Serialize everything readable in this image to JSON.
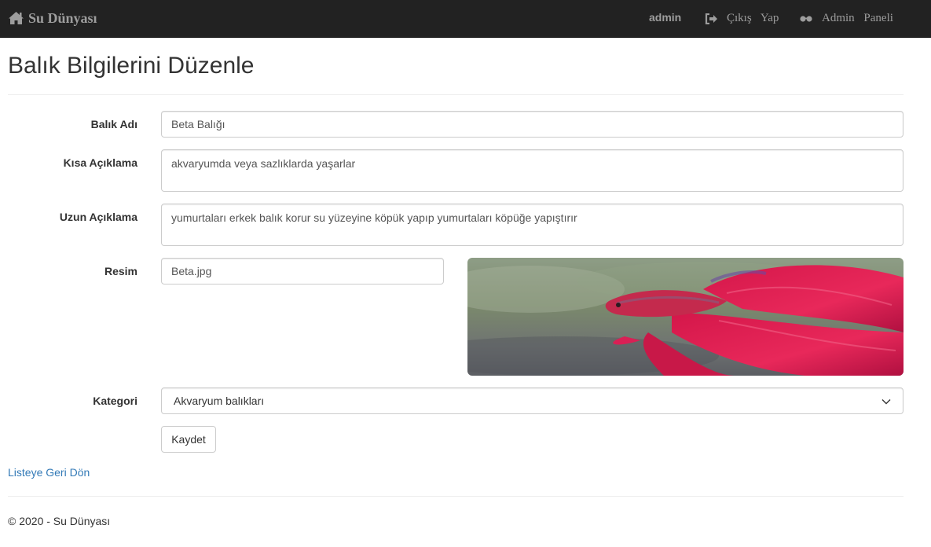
{
  "navbar": {
    "brand": "Su Dünyası",
    "user": "admin",
    "logout_label": "Çıkış Yap",
    "admin_panel_label": "Admin Paneli"
  },
  "page": {
    "title": "Balık Bilgilerini Düzenle"
  },
  "form": {
    "name_label": "Balık Adı",
    "name_value": "Beta Balığı",
    "short_desc_label": "Kısa Açıklama",
    "short_desc_value": "akvaryumda veya sazlıklarda yaşarlar",
    "long_desc_label": "Uzun Açıklama",
    "long_desc_value": "yumurtaları erkek balık korur su yüzeyine köpük yapıp yumurtaları köpüğe yapıştırır",
    "image_label": "Resim",
    "image_value": "Beta.jpg",
    "category_label": "Kategori",
    "category_value": "Akvaryum balıkları",
    "save_label": "Kaydet"
  },
  "links": {
    "back_label": "Listeye Geri Dön"
  },
  "footer": {
    "text": "© 2020 - Su Dünyası"
  },
  "icons": {
    "brand": "home-icon",
    "logout": "sign-out-icon",
    "admin": "sunglasses-icon",
    "select": "chevron-down-icon"
  },
  "colors": {
    "navbar_bg": "#222222",
    "navbar_text": "#9d9d9d",
    "link": "#337ab7",
    "border": "#cccccc"
  }
}
